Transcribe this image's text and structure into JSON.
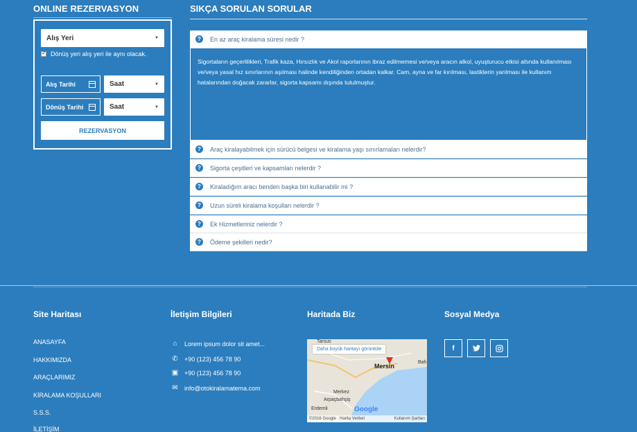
{
  "reservation": {
    "title": "ONLINE REZERVASYON",
    "pickup_location": "Alış Yeri",
    "same_location_label": "Dönüş yeri alış yeri ile aynı olacak.",
    "pickup_date": "Alış Tarihi",
    "return_date": "Dönüş Tarihi",
    "time_placeholder": "Saat",
    "submit": "REZERVASYON"
  },
  "faq": {
    "title": "SIKÇA SORULAN SORULAR",
    "items": [
      "En az araç kiralama süresi nedir ?",
      "Araç kiralayabilmek için sürücü belgesi ve kiralama yaşı sınırlamaları nelerdir?",
      "Sigorta çeşitleri ve kapsamları nelerdir ?",
      "Kiraladığım aracı benden başka biri kullanabilir mi ?",
      "Uzun süreli kiralama koşulları nelerdir ?",
      "Ek Hizmetleriniz nelerdir ?",
      "Ödeme şekilleri nedir?"
    ],
    "answer": "Sigortaların geçerlilikleri, Trafik kaza, Hırsızlık ve Akol raporlarının ibraz edilmemesi ve/veya aracın alkol, uyuşturucu etkisi altında kullanılması ve/veya yasal hız sınırlarının aşılması halinde kendiliğinden ortadan kalkar. Cam, ayna ve far kırılması, lastiklerin yarılması ile kullanım hatalarından doğacak zararlar, sigorta kapsamı dışında tutulmuştur."
  },
  "footer": {
    "sitemap_title": "Site Haritası",
    "sitemap": [
      "ANASAYFA",
      "HAKKIMIZDA",
      "ARAÇLARIMIZ",
      "KİRALAMA KOŞULLARI",
      "S.S.S.",
      "İLETİŞİM"
    ],
    "contact_title": "İletişim Bilgileri",
    "contact": {
      "address": "Lorem ipsum dolor sit amet...",
      "phone": "+90 (123) 456 78 90",
      "fax": "+90 (123) 456 78 90",
      "email": "info@otokiralamatema.com"
    },
    "map_title": "Haritada Biz",
    "map": {
      "view_larger": "Daha büyük haritayı görüntüle",
      "city": "Mersin",
      "district": "Merkez",
      "places": [
        "Tarsus",
        "Bah",
        "Arpaçbahşiş",
        "Erdemli"
      ],
      "logo": "Google",
      "copyright": "©2016 Google · Harita Verileri",
      "terms": "Kullanım Şartları"
    },
    "social_title": "Sosyal Medya"
  },
  "colors": {
    "background": "#2b7dbd",
    "panel": "#ffffff",
    "text": "#ffffff"
  },
  "icons": [
    "question-circle-icon",
    "calendar-icon",
    "home-icon",
    "phone-icon",
    "fax-icon",
    "envelope-icon",
    "facebook-icon",
    "twitter-icon",
    "instagram-icon"
  ]
}
